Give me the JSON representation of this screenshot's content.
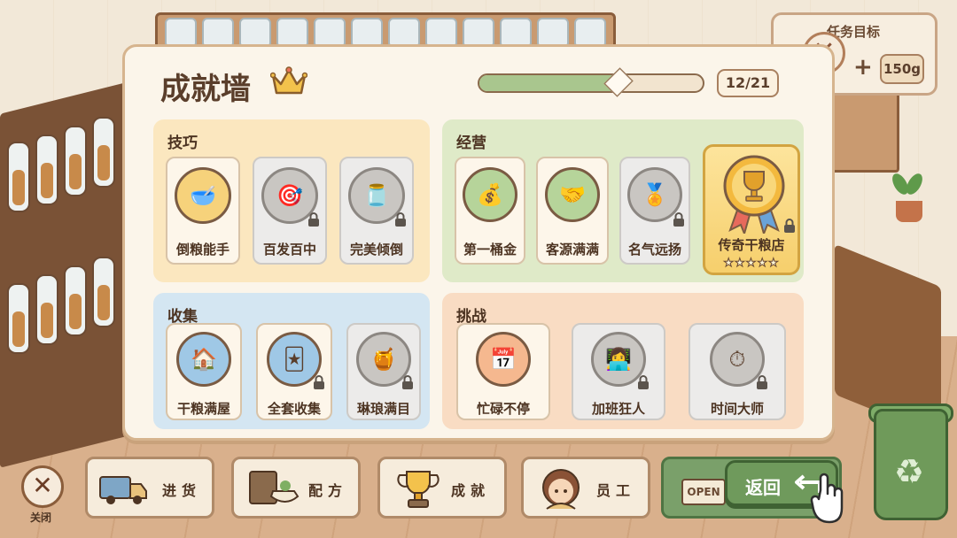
{
  "task": {
    "title": "任务目标",
    "weight": "150g"
  },
  "modal": {
    "title": "成就墙",
    "progress": {
      "fraction": 0.62,
      "count": "12/21"
    }
  },
  "sections": {
    "skill": {
      "title": "技巧",
      "items": [
        {
          "label": "倒粮能手",
          "locked": false,
          "icon": "scoop-pour-icon"
        },
        {
          "label": "百发百中",
          "locked": true,
          "icon": "target-icon"
        },
        {
          "label": "完美倾倒",
          "locked": true,
          "icon": "pour-jar-icon"
        }
      ]
    },
    "business": {
      "title": "经营",
      "items": [
        {
          "label": "第一桶金",
          "locked": false,
          "icon": "money-bag-icon"
        },
        {
          "label": "客源满满",
          "locked": false,
          "icon": "handshake-icon"
        },
        {
          "label": "名气远扬",
          "locked": true,
          "icon": "medal-icon"
        }
      ],
      "legend": {
        "label": "传奇干粮店",
        "stars": "★★★★★",
        "icon": "trophy-icon"
      }
    },
    "collect": {
      "title": "收集",
      "items": [
        {
          "label": "干粮满屋",
          "locked": false,
          "icon": "house-icon"
        },
        {
          "label": "全套收集",
          "locked": true,
          "icon": "cards-icon"
        },
        {
          "label": "琳琅满目",
          "locked": true,
          "icon": "jars-icon"
        }
      ]
    },
    "challenge": {
      "title": "挑战",
      "items": [
        {
          "label": "忙碌不停",
          "locked": false,
          "icon": "calendar-clock-icon"
        },
        {
          "label": "加班狂人",
          "locked": true,
          "icon": "worker-icon"
        },
        {
          "label": "时间大师",
          "locked": true,
          "icon": "stopwatch-icon"
        }
      ]
    }
  },
  "bottom_bar": {
    "close_label": "关闭",
    "buttons": [
      {
        "label": "进货",
        "icon": "truck-icon"
      },
      {
        "label": "配方",
        "icon": "recipe-book-icon"
      },
      {
        "label": "成就",
        "icon": "trophy-icon"
      },
      {
        "label": "员工",
        "icon": "staff-avatar-icon"
      }
    ],
    "open_sign": "OPEN",
    "return_label": "返回"
  },
  "colors": {
    "accent_green": "#6f9a5c",
    "skill_bg": "#fbe7bf",
    "business_bg": "#dfeac8",
    "collect_bg": "#d4e6f2",
    "challenge_bg": "#f9dcc3",
    "legend_gold": "#f6cf6c"
  }
}
